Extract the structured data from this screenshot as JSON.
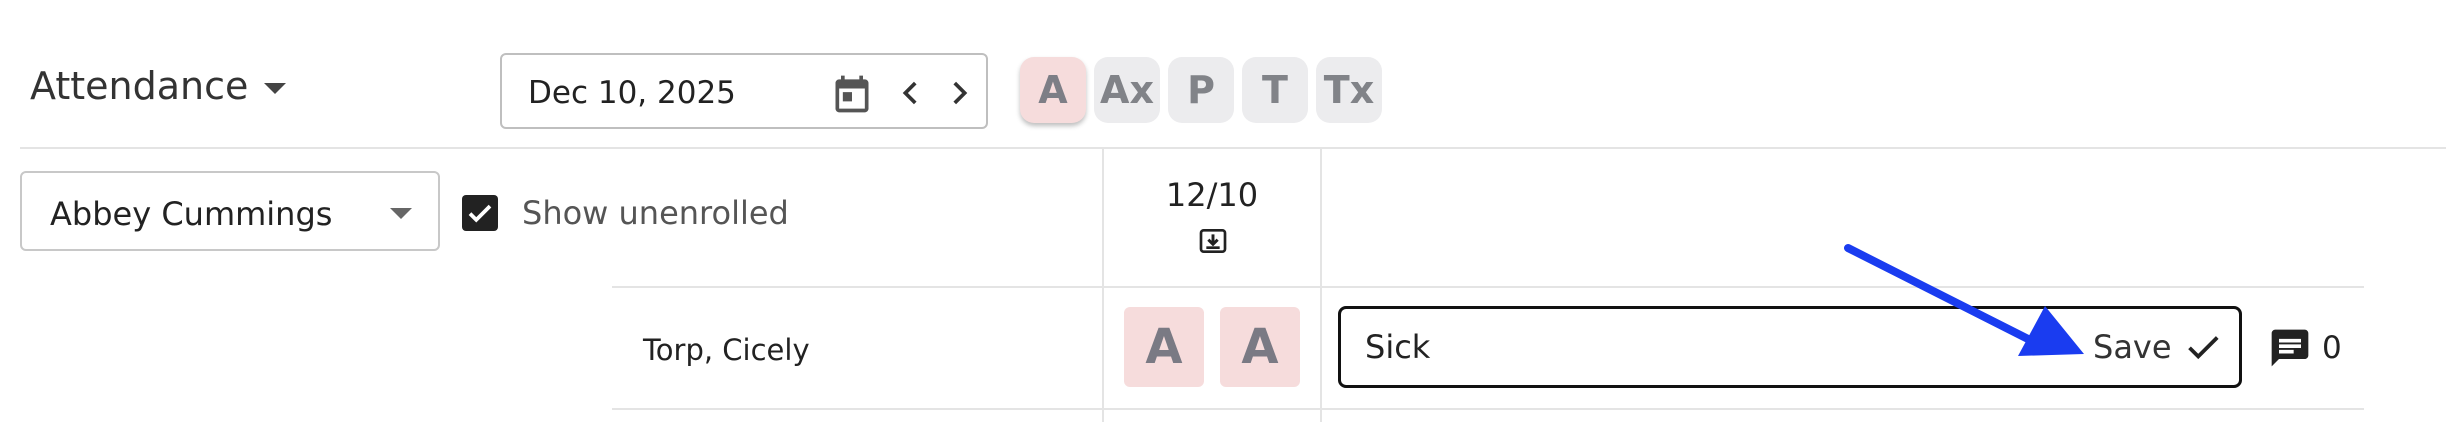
{
  "header": {
    "title": "Attendance",
    "date_value": "Dec 10, 2025",
    "status_codes": [
      "A",
      "Ax",
      "P",
      "T",
      "Tx"
    ],
    "active_status": "A"
  },
  "filters": {
    "student_select": "Abbey Cummings",
    "show_unenrolled_label": "Show unenrolled",
    "show_unenrolled_checked": true
  },
  "grid": {
    "date_column": "12/10",
    "rows": [
      {
        "student": "Torp, Cicely",
        "marks": [
          "A",
          "A"
        ],
        "note": "Sick",
        "save_label": "Save",
        "comment_count": "0"
      }
    ]
  },
  "colors": {
    "absent_bg": "#f6dcdc",
    "status_bg": "#ececee",
    "annotation_arrow": "#1a3cf0"
  }
}
